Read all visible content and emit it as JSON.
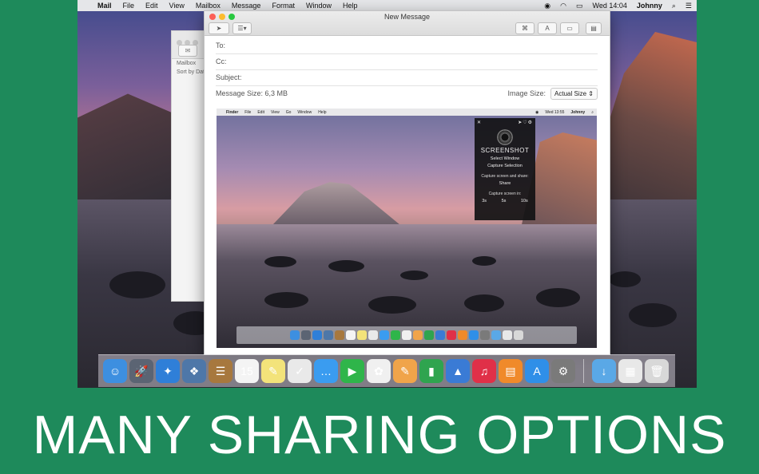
{
  "menubar": {
    "app_name": "Mail",
    "menus": [
      "File",
      "Edit",
      "View",
      "Mailbox",
      "Message",
      "Format",
      "Window",
      "Help"
    ],
    "clock": "Wed 14:04",
    "user": "Johnny"
  },
  "back_window": {
    "title": "Mailbox",
    "sort_label": "Sort by Date"
  },
  "compose": {
    "window_title": "New Message",
    "to_label": "To:",
    "cc_label": "Cc:",
    "subject_label": "Subject:",
    "message_size_label": "Message Size: 6,3 MB",
    "image_size_label": "Image Size:",
    "image_size_value": "Actual Size"
  },
  "attached_screenshot": {
    "menubar": {
      "app_name": "Finder",
      "menus": [
        "File",
        "Edit",
        "View",
        "Go",
        "Window",
        "Help"
      ],
      "clock": "Wed 13:55",
      "user": "Johnny"
    },
    "popup": {
      "brand": "SCREENSHOT",
      "select_window": "Select Window",
      "capture_selection": "Capture Selection",
      "capture_share_label": "Capture screen and share:",
      "share": "Share",
      "capture_in_label": "Capture screen in:",
      "timers": [
        "3s",
        "5s",
        "10s"
      ]
    }
  },
  "dock": {
    "apps": [
      {
        "name": "finder",
        "glyph": "☺",
        "color": "#3d8fe0"
      },
      {
        "name": "launchpad",
        "glyph": "🚀",
        "color": "#5b6473"
      },
      {
        "name": "safari",
        "glyph": "✦",
        "color": "#2f7fd8"
      },
      {
        "name": "preview",
        "glyph": "❖",
        "color": "#4e77a8"
      },
      {
        "name": "contacts",
        "glyph": "☰",
        "color": "#a7783e"
      },
      {
        "name": "calendar",
        "glyph": "15",
        "color": "#f4f4f4"
      },
      {
        "name": "notes",
        "glyph": "✎",
        "color": "#f3e37a"
      },
      {
        "name": "reminders",
        "glyph": "✓",
        "color": "#e9e9e9"
      },
      {
        "name": "messages",
        "glyph": "…",
        "color": "#3a9cf0"
      },
      {
        "name": "facetime",
        "glyph": "▶",
        "color": "#2fb54a"
      },
      {
        "name": "photos",
        "glyph": "✿",
        "color": "#f0f0f0"
      },
      {
        "name": "pages",
        "glyph": "✎",
        "color": "#f0a44a"
      },
      {
        "name": "numbers",
        "glyph": "▮",
        "color": "#2fa44f"
      },
      {
        "name": "keynote",
        "glyph": "▲",
        "color": "#3a7bd5"
      },
      {
        "name": "itunes",
        "glyph": "♫",
        "color": "#e03048"
      },
      {
        "name": "ibooks",
        "glyph": "▤",
        "color": "#f08a2a"
      },
      {
        "name": "app-store",
        "glyph": "A",
        "color": "#2f8fe8"
      },
      {
        "name": "system-preferences",
        "glyph": "⚙",
        "color": "#7a7a7a"
      }
    ],
    "stacks": [
      {
        "name": "downloads",
        "glyph": "↓",
        "color": "#5aa8e6"
      },
      {
        "name": "documents",
        "glyph": "▦",
        "color": "#e8e8e8"
      },
      {
        "name": "trash",
        "glyph": "🗑",
        "color": "#d8d8d8"
      }
    ]
  },
  "headline": "MANY SHARING OPTIONS"
}
